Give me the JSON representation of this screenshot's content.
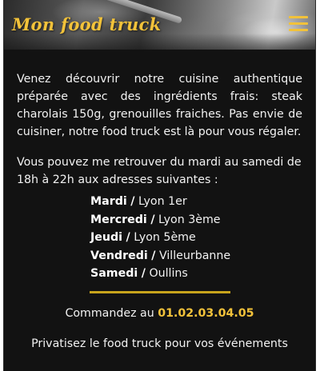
{
  "header": {
    "brand_title": "Mon food truck",
    "menu_icon": "hamburger-menu-icon"
  },
  "main": {
    "intro": "Venez découvrir notre cuisine authentique préparée avec des ingrédients frais: steak charolais 150g, grenouilles fraiches. Pas envie de cuisiner, notre food truck est là pour vous régaler.",
    "availability": "Vous pouvez me retrouver du mardi au samedi de 18h à 22h aux adresses suivantes :",
    "separator": "/",
    "schedule": [
      {
        "day": "Mardi",
        "location": "Lyon 1er"
      },
      {
        "day": "Mercredi",
        "location": "Lyon 3ème"
      },
      {
        "day": "Jeudi",
        "location": "Lyon 5ème"
      },
      {
        "day": "Vendredi",
        "location": "Villeurbanne"
      },
      {
        "day": "Samedi",
        "location": "Oullins"
      }
    ],
    "order_label": "Commandez au",
    "order_phone": "01.02.03.04.05",
    "private_event": "Privatisez le food truck pour vos événements"
  },
  "colors": {
    "accent": "#f2c23a",
    "divider": "#c8a41c",
    "background": "#121212",
    "text": "#f2f2f2"
  }
}
